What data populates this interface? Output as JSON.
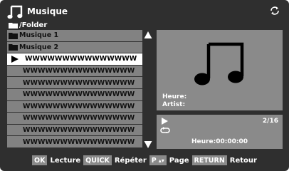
{
  "header": {
    "app_icon": "music-note-icon",
    "title": "Musique",
    "refresh_icon": "refresh-icon"
  },
  "path": {
    "icon": "folder-icon",
    "text": "/Folder"
  },
  "list": {
    "items": [
      {
        "type": "folder",
        "label": "Musique 1"
      },
      {
        "type": "folder",
        "label": "Musique 2"
      },
      {
        "type": "track",
        "label": "WWWWWWWWWWWWWWW",
        "selected": true
      },
      {
        "type": "track",
        "label": "WWWWWWWWWWWWWWW"
      },
      {
        "type": "track",
        "label": "WWWWWWWWWWWWWWW"
      },
      {
        "type": "track",
        "label": "WWWWWWWWWWWWWWW"
      },
      {
        "type": "track",
        "label": "WWWWWWWWWWWWWWW"
      },
      {
        "type": "track",
        "label": "WWWWWWWWWWWWWWW"
      },
      {
        "type": "track",
        "label": "WWWWWWWWWWWWWWW"
      },
      {
        "type": "track",
        "label": "WWWWWWWWWWWWWWW"
      }
    ],
    "scroll_up_icon": "triangle-up-icon",
    "scroll_down_icon": "triangle-down-icon"
  },
  "info": {
    "artwork_icon": "music-note-icon",
    "heure_label": "Heure:",
    "artist_label": "Artist:"
  },
  "playback": {
    "play_icon": "play-icon",
    "repeat_icon": "repeat-icon",
    "track_count": "2/16",
    "time": "Heure:00:00:00"
  },
  "footer": {
    "ok_key": "OK",
    "ok_label": "Lecture",
    "quick_key": "QUICK",
    "quick_label": "Répéter",
    "p_key": "P",
    "p_label": "Page",
    "return_key": "RETURN",
    "return_label": "Retour"
  },
  "colors": {
    "background": "#2f2f2f",
    "panel": "#8a8a8a",
    "row": "#828282",
    "selected_row": "#ffffff",
    "text": "#ffffff"
  }
}
